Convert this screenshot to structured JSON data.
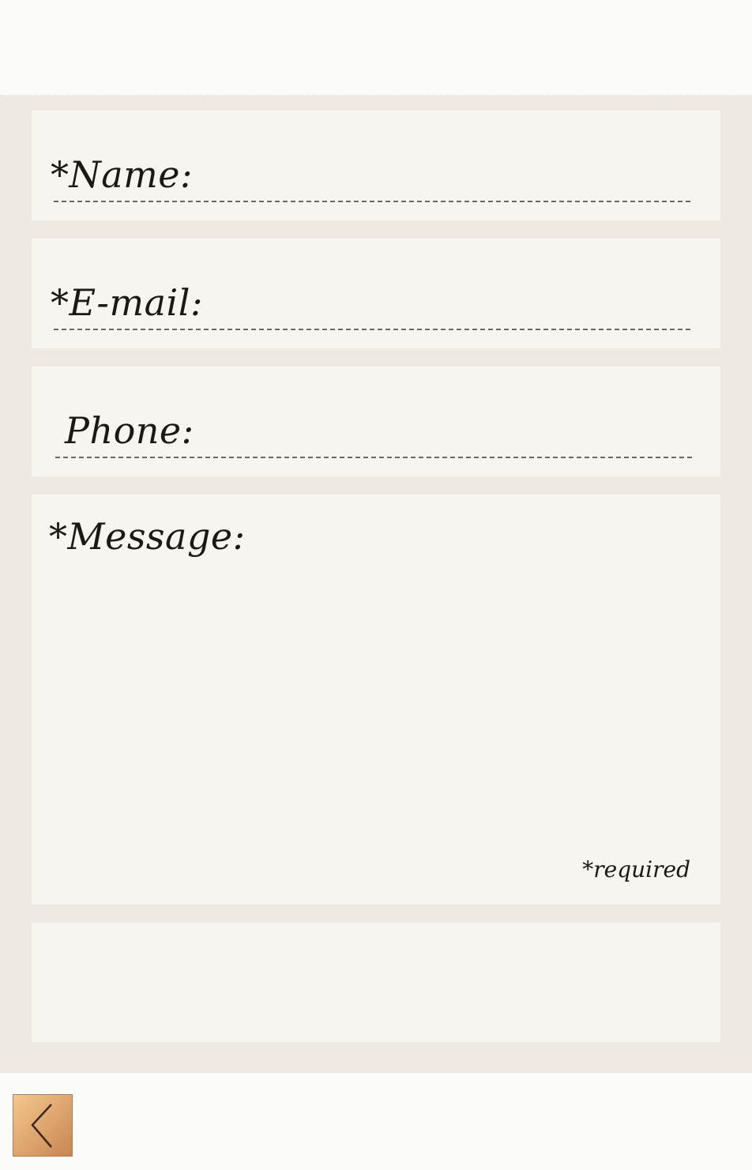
{
  "form": {
    "fields": [
      {
        "label": "*Name:"
      },
      {
        "label": "*E-mail:"
      },
      {
        "label": "Phone:"
      },
      {
        "label": "*Message:"
      }
    ],
    "required_note": "*required"
  },
  "navigation": {
    "back_icon": "chevron-left-icon"
  },
  "colors": {
    "page_background": "#fbfbfa",
    "form_background": "#eeeae3",
    "card_background": "#f6f5f0",
    "text": "#1c1814",
    "back_button_accent": "#dfa76f"
  }
}
